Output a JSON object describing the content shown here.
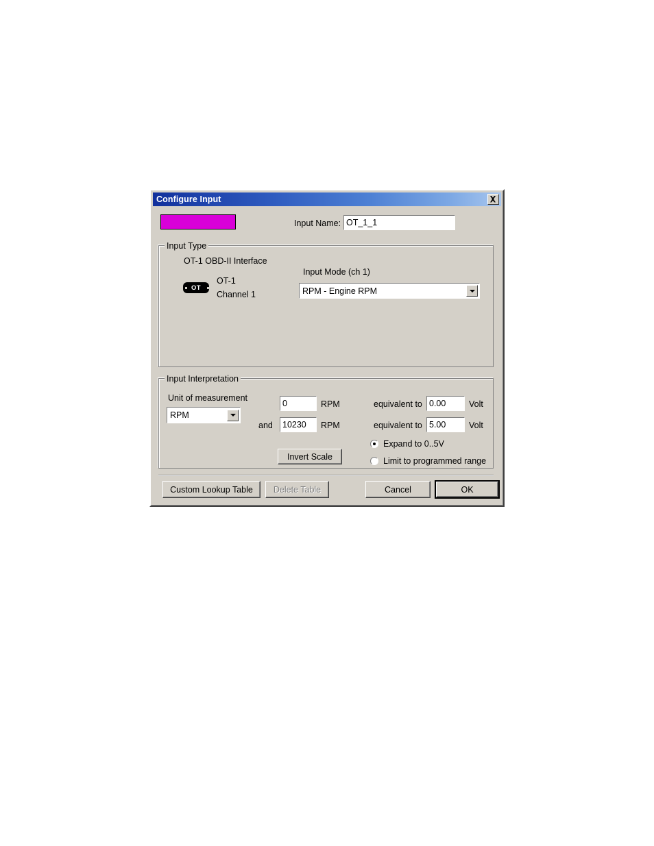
{
  "dialog": {
    "title": "Configure Input",
    "close_icon": "close-icon"
  },
  "header": {
    "color_swatch": "#d900d9",
    "input_name_label": "Input Name:",
    "input_name_value": "OT_1_1"
  },
  "input_type": {
    "group_title": "Input Type",
    "interface_label": "OT-1 OBD-II Interface",
    "badge_text": "OT",
    "device_line1": "OT-1",
    "device_line2": "Channel 1",
    "input_mode_label": "Input Mode (ch 1)",
    "input_mode_value": "RPM - Engine RPM",
    "dropdown_icon": "chevron-down-icon"
  },
  "input_interpretation": {
    "group_title": "Input Interpretation",
    "unit_label": "Unit of measurement",
    "unit_value": "RPM",
    "unit_dropdown_icon": "chevron-down-icon",
    "range_min_value": "0",
    "range_min_unit": "RPM",
    "and_label": "and",
    "range_max_value": "10230",
    "range_max_unit": "RPM",
    "equivalent_label_1": "equivalent to",
    "volt_min_value": "0.00",
    "volt_unit_1": "Volt",
    "equivalent_label_2": "equivalent to",
    "volt_max_value": "5.00",
    "volt_unit_2": "Volt",
    "invert_scale_label": "Invert Scale",
    "radio_expand_label": "Expand to 0..5V",
    "radio_limit_label": "Limit to programmed range",
    "radio_selected": "expand"
  },
  "footer": {
    "custom_lookup_label": "Custom Lookup Table",
    "delete_table_label": "Delete Table",
    "delete_table_enabled": false,
    "cancel_label": "Cancel",
    "ok_label": "OK"
  }
}
